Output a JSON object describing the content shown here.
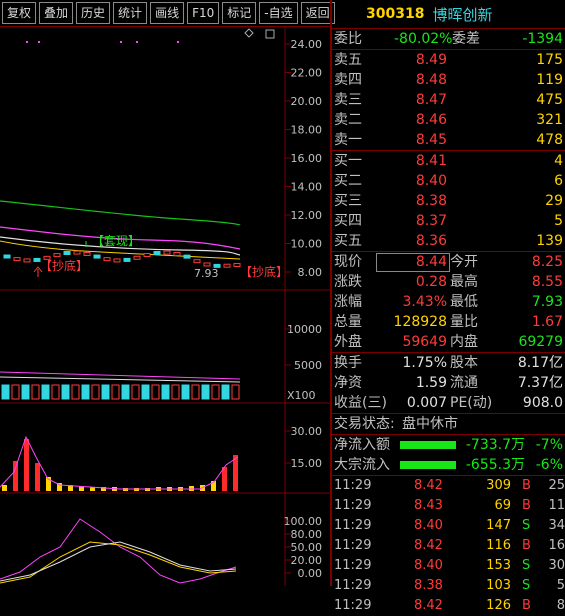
{
  "toolbar": {
    "buttons": [
      "复权",
      "叠加",
      "历史",
      "统计",
      "画线",
      "F10",
      "标记",
      "-自选",
      "返回"
    ]
  },
  "header": {
    "code": "300318",
    "name": "博晖创新"
  },
  "commission": {
    "ratio_label": "委比",
    "ratio_value": "-80.02%",
    "diff_label": "委差",
    "diff_value": "-1394"
  },
  "asks": [
    {
      "label": "卖五",
      "price": "8.49",
      "volume": "175"
    },
    {
      "label": "卖四",
      "price": "8.48",
      "volume": "119"
    },
    {
      "label": "卖三",
      "price": "8.47",
      "volume": "475"
    },
    {
      "label": "卖二",
      "price": "8.46",
      "volume": "321"
    },
    {
      "label": "卖一",
      "price": "8.45",
      "volume": "478"
    }
  ],
  "bids": [
    {
      "label": "买一",
      "price": "8.41",
      "volume": "4"
    },
    {
      "label": "买二",
      "price": "8.40",
      "volume": "6"
    },
    {
      "label": "买三",
      "price": "8.38",
      "volume": "29"
    },
    {
      "label": "买四",
      "price": "8.37",
      "volume": "5"
    },
    {
      "label": "买五",
      "price": "8.36",
      "volume": "139"
    }
  ],
  "quote": [
    [
      {
        "label": "现价",
        "value": "8.44"
      },
      {
        "label": "今开",
        "value": "8.25"
      }
    ],
    [
      {
        "label": "涨跌",
        "value": "0.28"
      },
      {
        "label": "最高",
        "value": "8.55"
      }
    ],
    [
      {
        "label": "涨幅",
        "value": "3.43%"
      },
      {
        "label": "最低",
        "value": "7.93"
      }
    ],
    [
      {
        "label": "总量",
        "value": "128928"
      },
      {
        "label": "量比",
        "value": "1.67"
      }
    ],
    [
      {
        "label": "外盘",
        "value": "59649"
      },
      {
        "label": "内盘",
        "value": "69279"
      }
    ]
  ],
  "fundamentals": [
    [
      {
        "label": "换手",
        "value": "1.75%"
      },
      {
        "label": "股本",
        "value": "8.17亿"
      }
    ],
    [
      {
        "label": "净资",
        "value": "1.59"
      },
      {
        "label": "流通",
        "value": "7.37亿"
      }
    ],
    [
      {
        "label": "收益(三)",
        "value": "0.007"
      },
      {
        "label": "PE(动)",
        "value": "908.0"
      }
    ]
  ],
  "trade_status": {
    "label": "交易状态:",
    "value": "盘中休市"
  },
  "flows": [
    {
      "label": "净流入额",
      "amount": "-733.7万",
      "pct": "-7%"
    },
    {
      "label": "大宗流入",
      "amount": "-655.3万",
      "pct": "-6%"
    }
  ],
  "ticks": [
    {
      "time": "11:29",
      "price": "8.42",
      "vol": "309",
      "side": "B",
      "count": "25"
    },
    {
      "time": "11:29",
      "price": "8.43",
      "vol": "69",
      "side": "B",
      "count": "11"
    },
    {
      "time": "11:29",
      "price": "8.40",
      "vol": "147",
      "side": "S",
      "count": "34"
    },
    {
      "time": "11:29",
      "price": "8.42",
      "vol": "116",
      "side": "B",
      "count": "16"
    },
    {
      "time": "11:29",
      "price": "8.40",
      "vol": "153",
      "side": "S",
      "count": "30"
    },
    {
      "time": "11:29",
      "price": "8.38",
      "vol": "103",
      "side": "S",
      "count": "5"
    },
    {
      "time": "11:29",
      "price": "8.42",
      "vol": "126",
      "side": "B",
      "count": "8"
    }
  ],
  "chart": {
    "price_axis": [
      "24.00",
      "22.00",
      "20.00",
      "18.00",
      "16.00",
      "14.00",
      "12.00",
      "10.00",
      "8.00"
    ],
    "volume_axis": [
      "10000",
      "5000"
    ],
    "volume_unit": "X100",
    "ind1_axis": [
      "30.00",
      "15.00"
    ],
    "ind2_axis": [
      "100.00",
      "80.00",
      "50.00",
      "20.00",
      "0.00"
    ],
    "annotations": {
      "top": "【套现】",
      "bottom_left": "【抄底】",
      "bottom_right": "【抄底】",
      "low_price": "7.93"
    }
  },
  "colors": {
    "up": "#ff3a3a",
    "down": "#19e619",
    "accent": "#ffd400",
    "border": "#7a0000"
  }
}
